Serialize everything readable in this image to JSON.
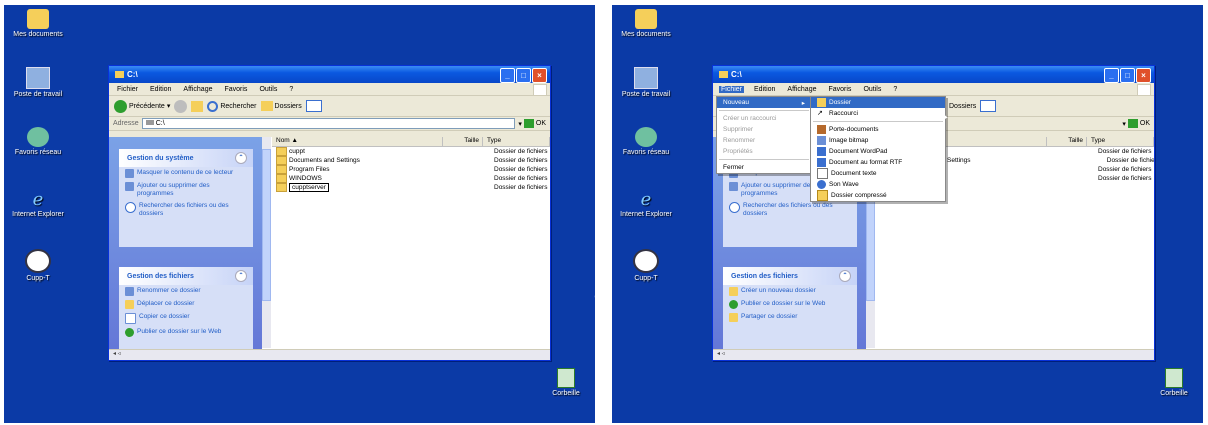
{
  "desktop": {
    "icons": [
      "Mes documents",
      "Poste de travail",
      "Favoris réseau",
      "Internet Explorer",
      "Cupp-T"
    ],
    "recycle_bin": "Corbeille"
  },
  "window": {
    "title": "C:\\",
    "menu": [
      "Fichier",
      "Edition",
      "Affichage",
      "Favoris",
      "Outils",
      "?"
    ],
    "toolbar": {
      "back": "Précédente",
      "search": "Rechercher",
      "folders": "Dossiers"
    },
    "address_label": "Adresse",
    "address_value": "C:\\",
    "go_label": "OK"
  },
  "task_pane": {
    "system_tasks": {
      "header": "Gestion du système",
      "items": [
        "Masquer le contenu de ce lecteur",
        "Ajouter ou supprimer des programmes",
        "Rechercher des fichiers ou des dossiers"
      ]
    },
    "file_tasks_left": {
      "header": "Gestion des fichiers",
      "items": [
        "Renommer ce dossier",
        "Déplacer ce dossier",
        "Copier ce dossier",
        "Publier ce dossier sur le Web"
      ]
    },
    "file_tasks_right": {
      "header": "Gestion des fichiers",
      "items": [
        "Créer un nouveau dossier",
        "Publier ce dossier sur le Web",
        "Partager ce dossier"
      ]
    }
  },
  "columns": {
    "name": "Nom",
    "size": "Taille",
    "type": "Type"
  },
  "files": [
    {
      "name": "cuppt",
      "type": "Dossier de fichiers"
    },
    {
      "name": "Documents and Settings",
      "type": "Dossier de fichiers"
    },
    {
      "name": "Program Files",
      "type": "Dossier de fichiers"
    },
    {
      "name": "WINDOWS",
      "type": "Dossier de fichiers"
    },
    {
      "name": "cupptserver",
      "type": "Dossier de fichiers"
    }
  ],
  "right_partial_file": "nd Settings",
  "file_menu": {
    "items": [
      "Nouveau",
      "Créer un raccourci",
      "Supprimer",
      "Renommer",
      "Propriétés",
      "Fermer"
    ]
  },
  "new_submenu": {
    "items": [
      "Dossier",
      "Raccourci",
      "Porte-documents",
      "Image bitmap",
      "Document WordPad",
      "Document au format RTF",
      "Document texte",
      "Son Wave",
      "Dossier compressé"
    ]
  }
}
